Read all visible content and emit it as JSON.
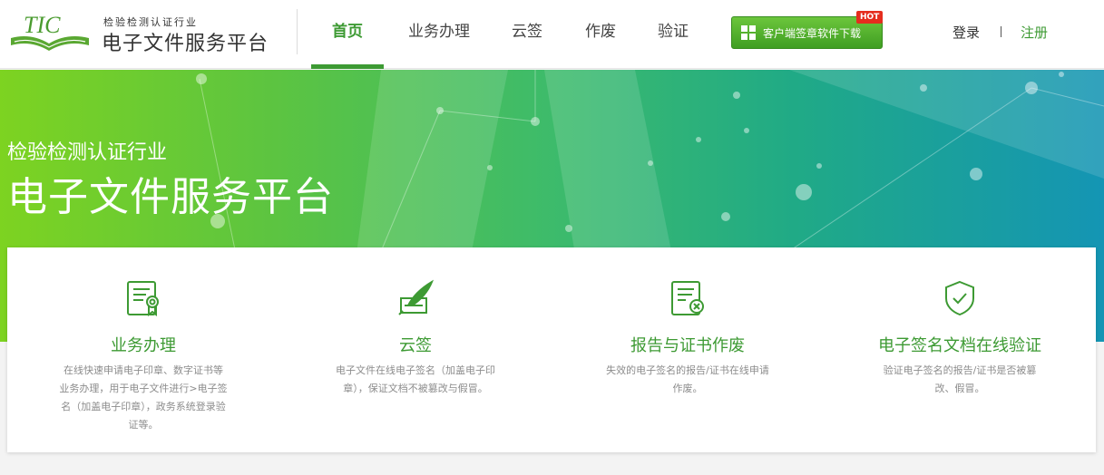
{
  "logo": {
    "mark_text": "TIC",
    "small_text": "检验检测认证行业",
    "big_text": "电子文件服务平台"
  },
  "nav": {
    "items": [
      {
        "label": "首页",
        "active": true
      },
      {
        "label": "业务办理",
        "active": false
      },
      {
        "label": "云签",
        "active": false
      },
      {
        "label": "作废",
        "active": false
      },
      {
        "label": "验证",
        "active": false
      }
    ]
  },
  "download": {
    "label": "客户端签章软件下载",
    "badge": "HOT",
    "icon": "windows-icon"
  },
  "auth": {
    "login": "登录",
    "register": "注册"
  },
  "banner": {
    "subtitle": "检验检测认证行业",
    "title": "电子文件服务平台"
  },
  "cards": [
    {
      "icon": "certificate-document-icon",
      "title": "业务办理",
      "desc": "在线快速申请电子印章、数字证书等业务办理，用于电子文件进行>电子签名（加盖电子印章），政务系统登录验证等。"
    },
    {
      "icon": "quill-signature-icon",
      "title": "云签",
      "desc": "电子文件在线电子签名（加盖电子印章），保证文档不被篡改与假冒。"
    },
    {
      "icon": "document-cancel-icon",
      "title": "报告与证书作废",
      "desc": "失效的电子签名的报告/证书在线申请作废。"
    },
    {
      "icon": "shield-check-icon",
      "title": "电子签名文档在线验证",
      "desc": "验证电子签名的报告/证书是否被篡改、假冒。"
    }
  ],
  "colors": {
    "brand_green": "#3d9a33",
    "hot_red": "#e52d1e",
    "banner_start": "#7dd321",
    "banner_end": "#1495b4"
  }
}
